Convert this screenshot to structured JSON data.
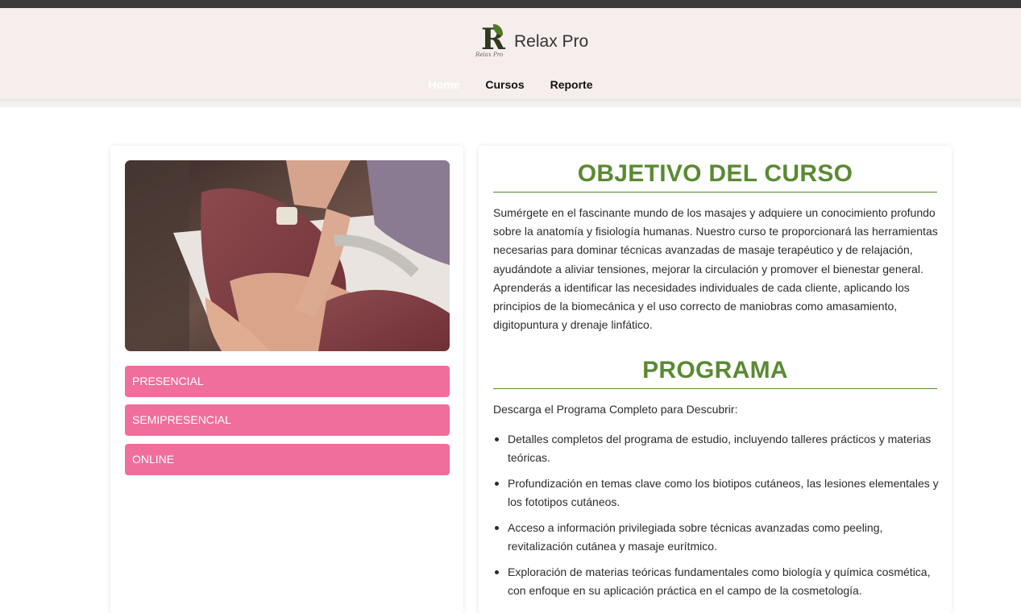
{
  "brand": {
    "name": "Relax Pro",
    "logo_letter": "R",
    "logo_script": "Relax Pro"
  },
  "nav": {
    "items": [
      {
        "label": "Home"
      },
      {
        "label": "Cursos"
      },
      {
        "label": "Reporte"
      }
    ]
  },
  "modes": [
    {
      "label": "PRESENCIAL"
    },
    {
      "label": "SEMIPRESENCIAL"
    },
    {
      "label": "ONLINE"
    }
  ],
  "objetivo": {
    "title": "OBJETIVO DEL CURSO",
    "text": "Sumérgete en el fascinante mundo de los masajes y adquiere un conocimiento profundo sobre la anatomía y fisiología humanas. Nuestro curso te proporcionará las herramientas necesarias para dominar técnicas avanzadas de masaje terapéutico y de relajación, ayudándote a aliviar tensiones, mejorar la circulación y promover el bienestar general. Aprenderás a identificar las necesidades individuales de cada cliente, aplicando los principios de la biomecánica y el uso correcto de maniobras como amasamiento, digitopuntura y drenaje linfático."
  },
  "programa": {
    "title": "PROGRAMA",
    "intro": "Descarga el Programa Completo para Descubrir:",
    "items": [
      "Detalles completos del programa de estudio, incluyendo talleres prácticos y materias teóricas.",
      "Profundización en temas clave como los biotipos cutáneos, las lesiones elementales y los fototipos cutáneos.",
      "Acceso a información privilegiada sobre técnicas avanzadas como peeling, revitalización cutánea y masaje eurítmico.",
      "Exploración de materias teóricas fundamentales como biología y química cosmética, con enfoque en su aplicación práctica en el campo de la cosmetología."
    ]
  },
  "colors": {
    "accent_green": "#5a8a33",
    "button_pink": "#ef6e9b",
    "header_bg": "#f6eded"
  }
}
